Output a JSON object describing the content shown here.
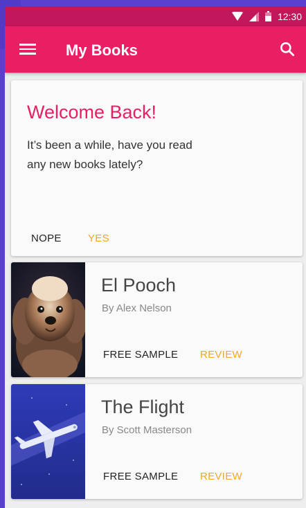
{
  "status_bar": {
    "time": "12:30"
  },
  "app_bar": {
    "title": "My Books",
    "menu_icon": "menu-icon",
    "search_icon": "search-icon"
  },
  "welcome": {
    "title": "Welcome Back!",
    "message": "It’s been a while, have you read any new books lately?",
    "actions": {
      "nope": "NOPE",
      "yes": "YES"
    }
  },
  "books": [
    {
      "title": "El Pooch",
      "author": "By Alex Nelson",
      "sample_label": "FREE SAMPLE",
      "review_label": "REVIEW",
      "cover": "dog-cover-image"
    },
    {
      "title": "The Flight",
      "author": "By Scott Masterson",
      "sample_label": "FREE SAMPLE",
      "review_label": "REVIEW",
      "cover": "airplane-cover-image"
    }
  ],
  "colors": {
    "primary": "#e91e63",
    "primary_dark": "#c2185b",
    "accent": "#f5a623",
    "background": "#5b3fd1"
  }
}
